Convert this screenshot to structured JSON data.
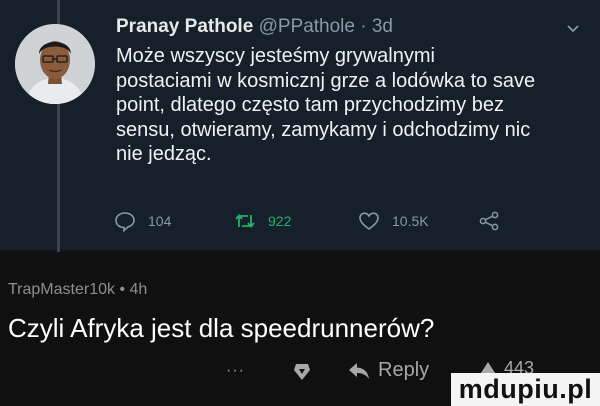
{
  "tweet": {
    "author_name": "Pranay Pathole",
    "handle": "@PPathole",
    "separator": " · ",
    "age": "3d",
    "text": "Może wszyscy jesteśmy grywalnymi postaciami w kosmicznj grze a lodówka to save point, dlatego często tam przychodzimy bez sensu, otwieramy, zamykamy i odchodzimy nic nie jedząc.",
    "actions": {
      "replies": "104",
      "retweets": "922",
      "likes": "10.5K"
    }
  },
  "comment": {
    "author": "TrapMaster10k",
    "separator": " • ",
    "age": "4h",
    "text": "Czyli Afryka jest dla speedrunnerów?",
    "more_label": "···",
    "reply_label": "Reply",
    "score": "443"
  },
  "watermark": "mdupiu.pl",
  "colors": {
    "tweet_bg": "#15202b",
    "page_bg": "#101010",
    "retweet_green": "#1fb26b"
  }
}
